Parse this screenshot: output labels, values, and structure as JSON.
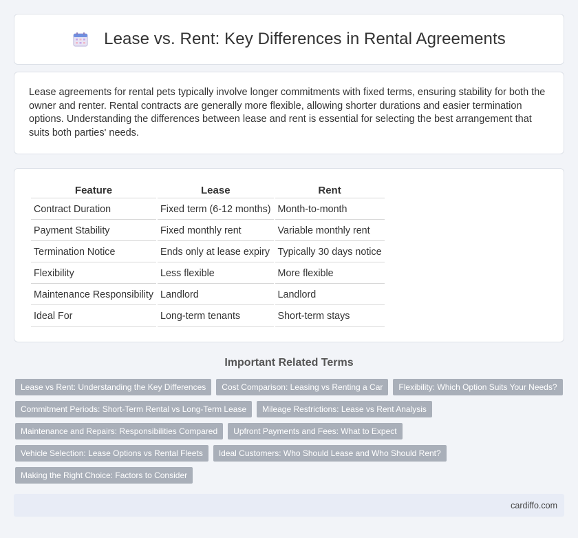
{
  "header": {
    "title": "Lease vs. Rent: Key Differences in Rental Agreements",
    "icon": "calendar-icon"
  },
  "intro": {
    "text": "Lease agreements for rental pets typically involve longer commitments with fixed terms, ensuring stability for both the owner and renter. Rental contracts are generally more flexible, allowing shorter durations and easier termination options. Understanding the differences between lease and rent is essential for selecting the best arrangement that suits both parties' needs."
  },
  "table": {
    "headers": [
      "Feature",
      "Lease",
      "Rent"
    ],
    "rows": [
      [
        "Contract Duration",
        "Fixed term (6-12 months)",
        "Month-to-month"
      ],
      [
        "Payment Stability",
        "Fixed monthly rent",
        "Variable monthly rent"
      ],
      [
        "Termination Notice",
        "Ends only at lease expiry",
        "Typically 30 days notice"
      ],
      [
        "Flexibility",
        "Less flexible",
        "More flexible"
      ],
      [
        "Maintenance Responsibility",
        "Landlord",
        "Landlord"
      ],
      [
        "Ideal For",
        "Long-term tenants",
        "Short-term stays"
      ]
    ]
  },
  "related": {
    "title": "Important Related Terms",
    "tags": [
      "Lease vs Rent: Understanding the Key Differences",
      "Cost Comparison: Leasing vs Renting a Car",
      "Flexibility: Which Option Suits Your Needs?",
      "Commitment Periods: Short-Term Rental vs Long-Term Lease",
      "Mileage Restrictions: Lease vs Rent Analysis",
      "Maintenance and Repairs: Responsibilities Compared",
      "Upfront Payments and Fees: What to Expect",
      "Vehicle Selection: Lease Options vs Rental Fleets",
      "Ideal Customers: Who Should Lease and Who Should Rent?",
      "Making the Right Choice: Factors to Consider"
    ]
  },
  "footer": {
    "site": "cardiffo.com"
  },
  "colors": {
    "background": "#f2f4f8",
    "card": "#ffffff",
    "tag": "#a9afb9",
    "footer": "#e8ecf6"
  }
}
